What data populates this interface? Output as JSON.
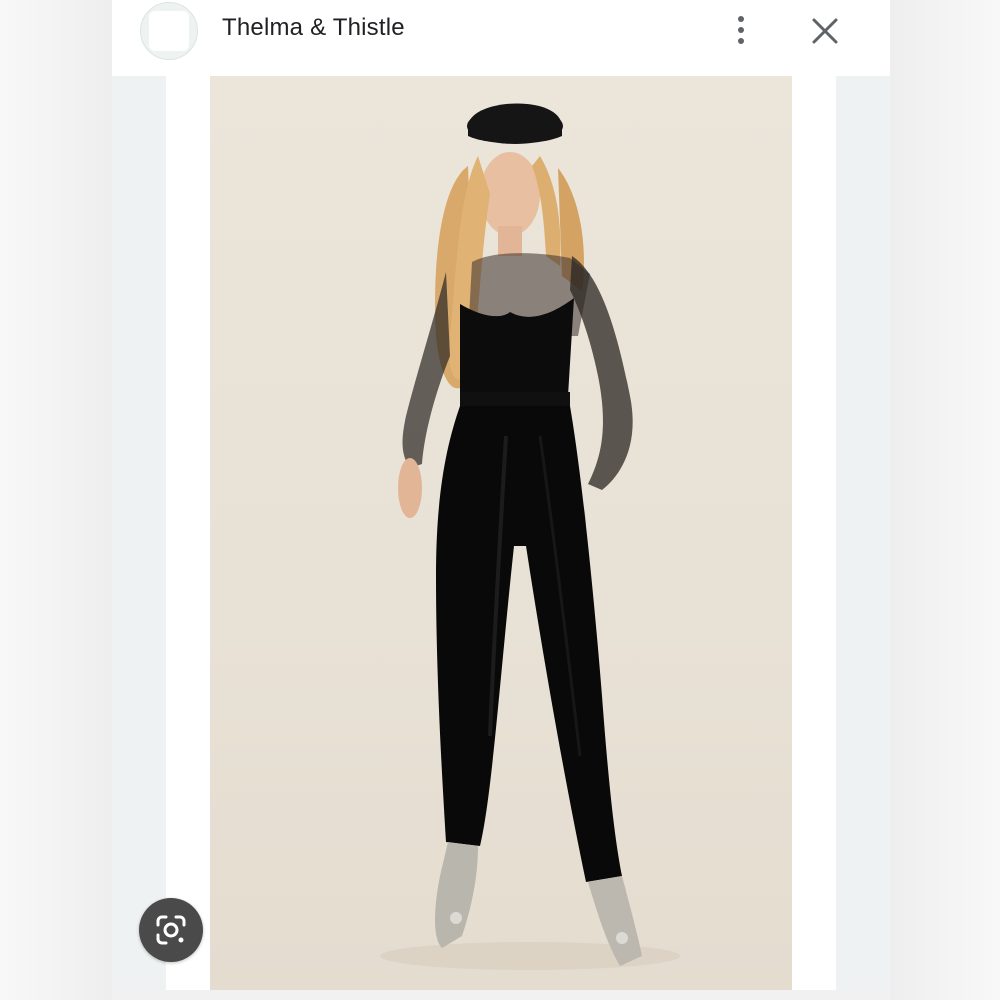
{
  "header": {
    "source_name": "Thelma & Thistle",
    "source_logo_icon": "site-favicon",
    "more_icon": "more-vert-icon",
    "close_icon": "close-icon"
  },
  "image": {
    "subject": "product-photo"
  },
  "lens": {
    "icon": "google-lens-icon"
  },
  "colors": {
    "header_text": "#202124",
    "icon_gray": "#5f6368",
    "lens_button": "#4a4a4a",
    "photo_background": "#e8e1d5"
  }
}
